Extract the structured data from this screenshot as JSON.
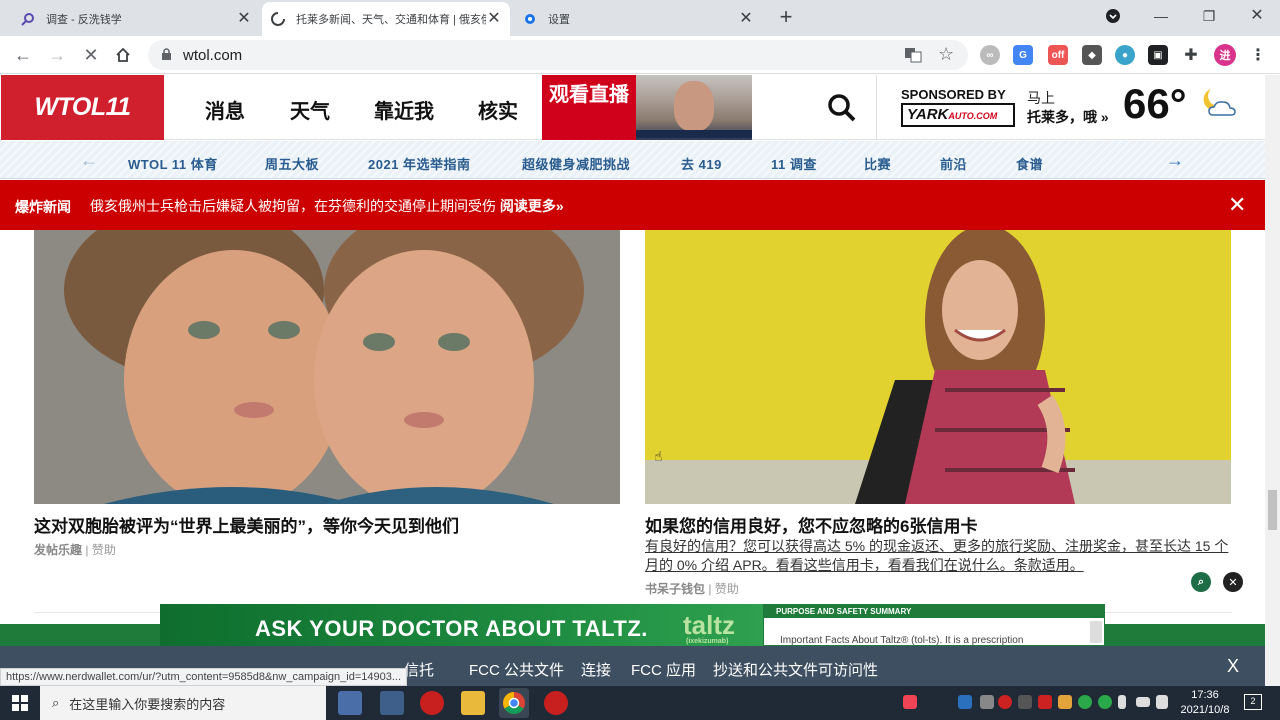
{
  "browser": {
    "tabs": [
      {
        "title": "调查 - 反洗钱学",
        "icon": "search-icon"
      },
      {
        "title": "托莱多新闻、天气、交通和体育 | 俄亥俄",
        "icon": "loading-icon"
      },
      {
        "title": "设置",
        "icon": "gear-icon"
      }
    ],
    "url": "wtol.com",
    "status_url": "https://www.nerdwallet.com/ur/?utm_content=9585d8&nw_campaign_id=14903...",
    "profile_initial": "进"
  },
  "site": {
    "logo": "WTOL11",
    "nav": [
      "消息",
      "天气",
      "靠近我",
      "核实"
    ],
    "watch_live": "观看直播",
    "sponsor": {
      "sponsored_by": "SPONSORED BY",
      "sponsor_name": "YARK",
      "sponsor_domain": "AUTO.COM",
      "line1": "马上",
      "line2": "托莱多，哦 »",
      "temperature": "66°"
    },
    "subnav": [
      "WTOL 11 体育",
      "周五大板",
      "2021 年选举指南",
      "超级健身减肥挑战",
      "去 419",
      "11 调查",
      "比赛",
      "前沿",
      "食谱"
    ],
    "breaking": {
      "label": "爆炸新闻",
      "text": "俄亥俄州士兵枪击后嫌疑人被拘留，在芬德利的交通停止期间受伤",
      "more": "阅读更多»"
    }
  },
  "articles": [
    {
      "headline": "这对双胞胎被评为“世界上最美丽的”，等你今天见到他们",
      "source": "发帖乐趣",
      "tag": "赞助"
    },
    {
      "headline": "如果您的信用良好，您不应忽略的6张信用卡",
      "desc": "有良好的信用？您可以获得高达 5% 的现金返还、更多的旅行奖励、注册奖金，甚至长达 15 个月的 0% 介绍 APR。看看这些信用卡，看看我们在说什么。条款适用。",
      "source": "书呆子钱包",
      "tag": "赞助"
    }
  ],
  "ad": {
    "headline": "ASK YOUR DOCTOR ABOUT TALTZ.",
    "brand": "taltz",
    "brand_sub": "(ixekizumab)",
    "panel_header": "PURPOSE AND SAFETY SUMMARY",
    "panel_body": "Important Facts About Taltz® (tol-ts). It is a prescription"
  },
  "footer": {
    "links": [
      "信托",
      "FCC 公共文件",
      "连接",
      "FCC 应用",
      "抄送和公共文件可访问性"
    ],
    "close": "X"
  },
  "taskbar": {
    "search_placeholder": "在这里输入你要搜索的内容",
    "time": "17:36",
    "date": "2021/10/8",
    "notifications": "2"
  },
  "colors": {
    "brand_red": "#d0202e",
    "breaking_red": "#cc0000",
    "footer_bg": "#3e4f61",
    "ad_green": "#1e7b3a"
  }
}
